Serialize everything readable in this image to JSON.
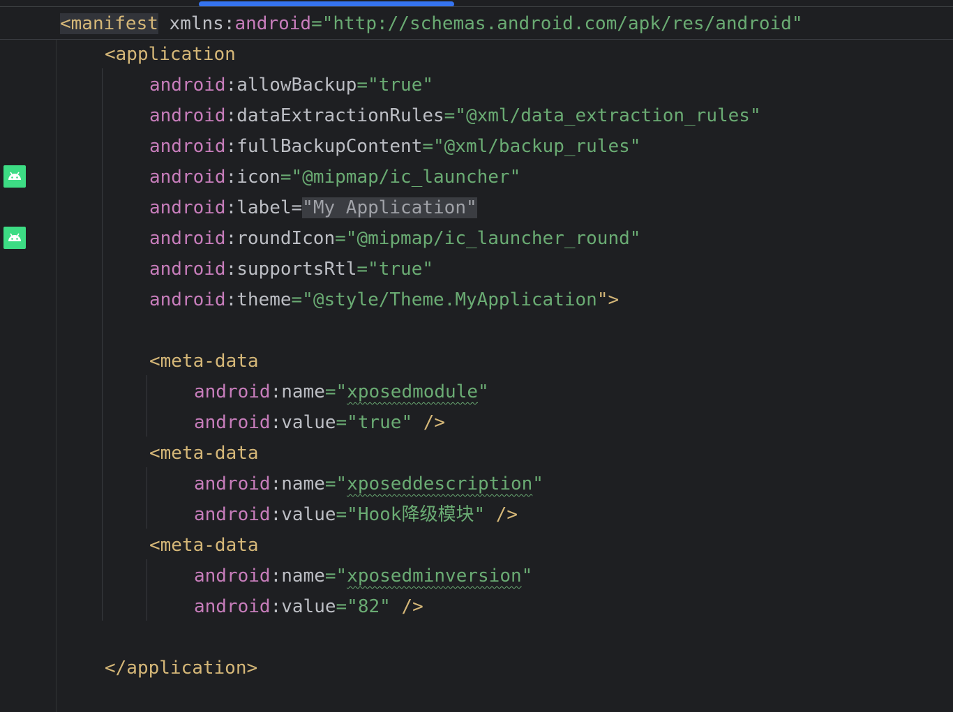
{
  "editor": {
    "sticky": {
      "open": "<",
      "tag": "manifest",
      "attr": "xmlns",
      "ns": "android",
      "eq": "=\"",
      "value": "http://schemas.android.com/apk/res/android",
      "close": "\""
    },
    "lines": {
      "app_open": "<application",
      "ns": "android",
      "colon": ":",
      "eq": "=\"",
      "quote": "\"",
      "allowBackup_attr": "allowBackup",
      "allowBackup_val": "true",
      "dataExtraction_attr": "dataExtractionRules",
      "dataExtraction_val": "@xml/data_extraction_rules",
      "fullBackup_attr": "fullBackupContent",
      "fullBackup_val": "@xml/backup_rules",
      "icon_attr": "icon",
      "icon_val": "@mipmap/ic_launcher",
      "label_attr": "label",
      "label_val": "My Application",
      "roundIcon_attr": "roundIcon",
      "roundIcon_val": "@mipmap/ic_launcher_round",
      "rtl_attr": "supportsRtl",
      "rtl_val": "true",
      "theme_attr": "theme",
      "theme_val": "@style/Theme.MyApplication",
      "theme_close": "\">",
      "meta_open": "<meta-data",
      "name_attr": "name",
      "value_attr": "value",
      "meta1_name": "xposedmodule",
      "meta1_value": "true",
      "meta2_name": "xposeddescription",
      "meta2_value": "Hook降级模块",
      "meta3_name": "xposedminversion",
      "meta3_value": "82",
      "selfclose": "\" />",
      "app_close": "</application>"
    }
  },
  "gutter_icons": [
    "android-icon",
    "android-icon"
  ],
  "colors": {
    "background": "#1e1f22",
    "tag": "#d5b778",
    "namespace": "#c77dbb",
    "string": "#6aab73",
    "attribute": "#bcbec4",
    "android_green": "#3ddc84",
    "scroll_indicator": "#3574f0"
  }
}
